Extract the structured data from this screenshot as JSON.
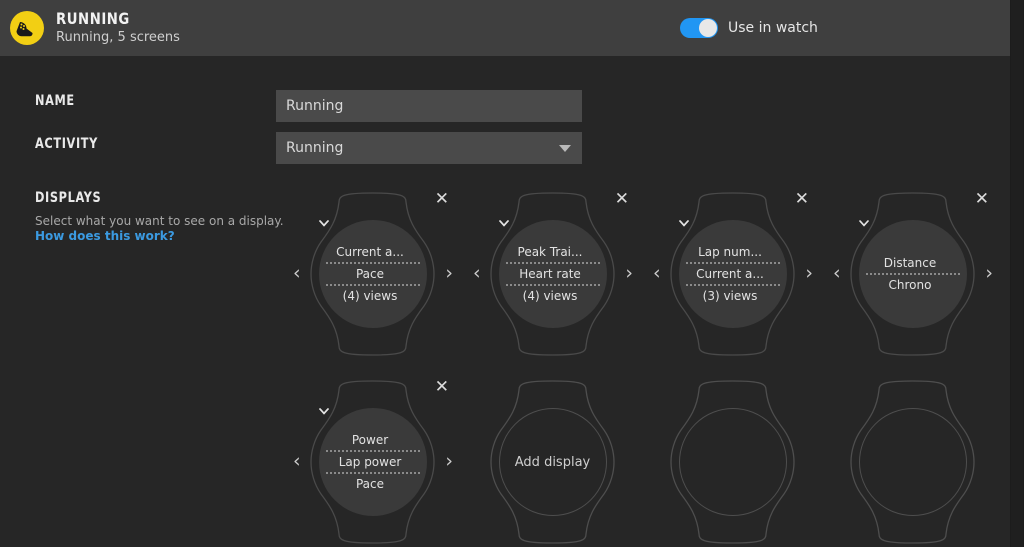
{
  "header": {
    "icon": "running-shoe-icon",
    "title": "RUNNING",
    "subtitle": "Running, 5 screens",
    "toggle_label": "Use in watch",
    "toggle_on": true,
    "accent_color": "#2196f3",
    "icon_color": "#f2cf14"
  },
  "form": {
    "name_label": "NAME",
    "name_value": "Running",
    "activity_label": "ACTIVITY",
    "activity_value": "Running",
    "dropdown_icon": "caret-down-icon"
  },
  "displays": {
    "section_title": "DISPLAYS",
    "description": "Select what you want to see on a display.",
    "link_text": "How does this work?",
    "link_color": "#3b9ae1",
    "nav_prev_icon": "chevron-left-icon",
    "nav_next_icon": "chevron-right-icon",
    "close_icon": "close-icon",
    "row_dropdown_icon": "chevron-down-icon",
    "add_label": "Add display",
    "cards": [
      {
        "type": "display",
        "rows": [
          "Current a...",
          "Pace",
          "(4) views"
        ]
      },
      {
        "type": "display",
        "rows": [
          "Peak Trai...",
          "Heart rate",
          "(4) views"
        ]
      },
      {
        "type": "display",
        "rows": [
          "Lap num...",
          "Current a...",
          "(3) views"
        ]
      },
      {
        "type": "display",
        "rows": [
          "Distance",
          "Chrono"
        ]
      },
      {
        "type": "display",
        "rows": [
          "Power",
          "Lap power",
          "Pace"
        ]
      },
      {
        "type": "add",
        "rows": []
      },
      {
        "type": "empty",
        "rows": []
      },
      {
        "type": "empty",
        "rows": []
      }
    ]
  }
}
